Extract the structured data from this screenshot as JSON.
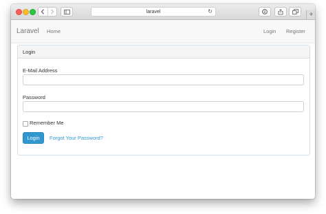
{
  "browser": {
    "address": "laravel",
    "new_tab_glyph": "+",
    "icons": [
      "back-icon",
      "forward-icon",
      "sidebar-icon",
      "reload-icon",
      "info-icon",
      "share-icon",
      "tabs-icon"
    ]
  },
  "navbar": {
    "brand": "Laravel",
    "home": "Home",
    "login": "Login",
    "register": "Register"
  },
  "panel": {
    "heading": "Login",
    "email_label": "E-Mail Address",
    "email_value": "",
    "password_label": "Password",
    "password_value": "",
    "remember_label": "Remember Me",
    "remember_checked": false,
    "submit_label": "Login",
    "forgot_label": "Forgot Your Password?"
  },
  "colors": {
    "primary": "#3097d1",
    "navbar_bg": "#f8f8f8",
    "panel_heading_bg": "#f5f5f5"
  }
}
